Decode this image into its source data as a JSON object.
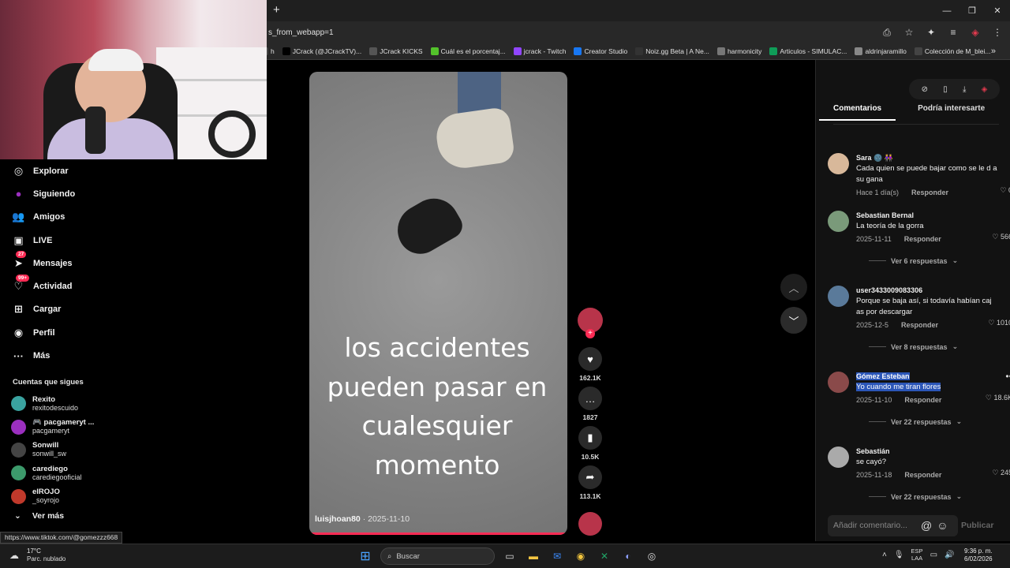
{
  "browser": {
    "new_tab_glyph": "+",
    "url": "s_from_webapp=1",
    "window_controls": [
      "—",
      "❐",
      "✕"
    ],
    "bookmarks": [
      {
        "label": "h",
        "color": "#444444"
      },
      {
        "label": "JCrack (@JCrackTV)...",
        "color": "#000000"
      },
      {
        "label": "JCrack KICKS",
        "color": "#555555"
      },
      {
        "label": "Cuál es el porcentaj...",
        "color": "#53c22b"
      },
      {
        "label": "jcrack - Twitch",
        "color": "#9146ff"
      },
      {
        "label": "Creator Studio",
        "color": "#1877f2"
      },
      {
        "label": "Noiz.gg Beta | A Ne...",
        "color": "#333333"
      },
      {
        "label": "harmonicity",
        "color": "#777777"
      },
      {
        "label": "Articulos - SIMULAC...",
        "color": "#0f9d58"
      },
      {
        "label": "aldrinjaramillo",
        "color": "#888888"
      },
      {
        "label": "Colección de M_blei...",
        "color": "#444444"
      }
    ],
    "bookmarks_more": "»",
    "status_url": "https://www.tiktok.com/@gomezzz668"
  },
  "sidebar": {
    "nav": [
      {
        "label": "Explorar",
        "icon": "compass-icon",
        "glyph": "◎",
        "badge": ""
      },
      {
        "label": "Siguiendo",
        "icon": "following-icon",
        "glyph": "●",
        "badge": ""
      },
      {
        "label": "Amigos",
        "icon": "friends-icon",
        "glyph": "👥",
        "badge": ""
      },
      {
        "label": "LIVE",
        "icon": "live-icon",
        "glyph": "▣",
        "badge": ""
      },
      {
        "label": "Mensajes",
        "icon": "messages-icon",
        "glyph": "➤",
        "badge": "27"
      },
      {
        "label": "Actividad",
        "icon": "activity-icon",
        "glyph": "♡",
        "badge": "99+"
      },
      {
        "label": "Cargar",
        "icon": "upload-icon",
        "glyph": "⊞",
        "badge": ""
      },
      {
        "label": "Perfil",
        "icon": "profile-icon",
        "glyph": "◉",
        "badge": ""
      },
      {
        "label": "Más",
        "icon": "more-icon",
        "glyph": "···",
        "badge": ""
      }
    ],
    "following_title": "Cuentas que sigues",
    "following": [
      {
        "name": "Rexito",
        "user": "rexitodescuido",
        "color": "#3aa3a0"
      },
      {
        "name": "🎮 pacgameryt ...",
        "user": "pacgameryt",
        "color": "#9b2fbf"
      },
      {
        "name": "Sonwill",
        "user": "sonwill_sw",
        "color": "#444444"
      },
      {
        "name": "carediego",
        "user": "carediegooficial",
        "color": "#3c9a6b"
      },
      {
        "name": "elROJO",
        "user": "_soyrojo",
        "color": "#c0392b"
      }
    ],
    "see_more": "Ver más"
  },
  "video": {
    "caption": "los accidentes pueden pasar en cualesquier momento",
    "author": "luisjhoan80",
    "date": "· 2025-11-10",
    "progress": 1.0
  },
  "actions": {
    "likes": "162.1K",
    "comments": "1827",
    "saves": "10.5K",
    "shares": "113.1K"
  },
  "panel": {
    "tabs": [
      "Comentarios",
      "Podría interesarte"
    ],
    "comments": [
      {
        "name": "Sara 🌚 👭",
        "text": "Cada quien se puede bajar como se le d a su gana",
        "date": "Hace 1 día(s)",
        "reply": "Responder",
        "likes": "0",
        "replies": "",
        "color": "#d8b89a"
      },
      {
        "name": "Sebastian Bernal",
        "text": "La teoría de la gorra",
        "date": "2025-11-11",
        "reply": "Responder",
        "likes": "566",
        "replies": "Ver 6 respuestas",
        "color": "#7a9a7a"
      },
      {
        "name": "user3433009083306",
        "text": "Porque se baja así, si todavía habían caj as por descargar",
        "date": "2025-12-5",
        "reply": "Responder",
        "likes": "1010",
        "replies": "Ver 8 respuestas",
        "color": "#5a7a9a"
      },
      {
        "name": "Gómez Esteban",
        "text": "Yo cuando me tiran flores",
        "date": "2025-11-10",
        "reply": "Responder",
        "likes": "18.6K",
        "replies": "Ver 22 respuestas",
        "color": "#8a4a4a"
      },
      {
        "name": "Sebastián",
        "text": "se cayó?",
        "date": "2025-11-18",
        "reply": "Responder",
        "likes": "245",
        "replies": "Ver 22 respuestas",
        "color": "#aaaaaa"
      }
    ],
    "add_comment_placeholder": "Añadir comentario...",
    "publish": "Publicar"
  },
  "taskbar": {
    "temperature": "17°C",
    "weather": "Parc. nublado",
    "search_placeholder": "Buscar",
    "lang_top": "ESP",
    "lang_bottom": "LAA",
    "time": "9:36 p. m.",
    "date": "6/02/2026"
  }
}
